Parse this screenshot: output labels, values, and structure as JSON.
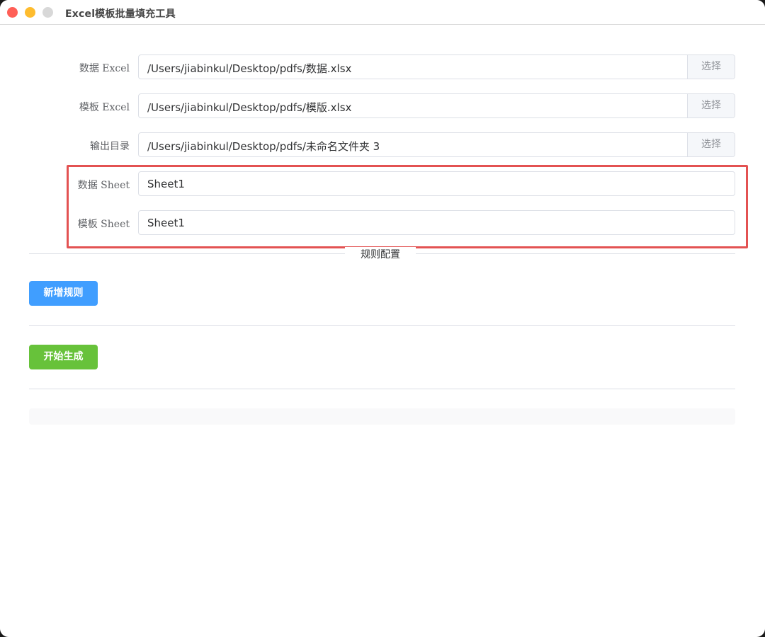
{
  "window": {
    "title": "Excel模板批量填充工具"
  },
  "form": {
    "data_excel": {
      "label": "数据 Excel",
      "value": "/Users/jiabinkul/Desktop/pdfs/数据.xlsx",
      "button": "选择"
    },
    "template_excel": {
      "label": "模板 Excel",
      "value": "/Users/jiabinkul/Desktop/pdfs/模版.xlsx",
      "button": "选择"
    },
    "output_dir": {
      "label": "输出目录",
      "value": "/Users/jiabinkul/Desktop/pdfs/未命名文件夹 3",
      "button": "选择"
    },
    "data_sheet": {
      "label": "数据 Sheet",
      "value": "Sheet1"
    },
    "template_sheet": {
      "label": "模板 Sheet",
      "value": "Sheet1"
    }
  },
  "rules": {
    "section_title": "规则配置",
    "add_button": "新增规则"
  },
  "actions": {
    "generate_button": "开始生成"
  },
  "colors": {
    "highlight": "#e35252",
    "primary": "#409eff",
    "success": "#67c23a"
  }
}
